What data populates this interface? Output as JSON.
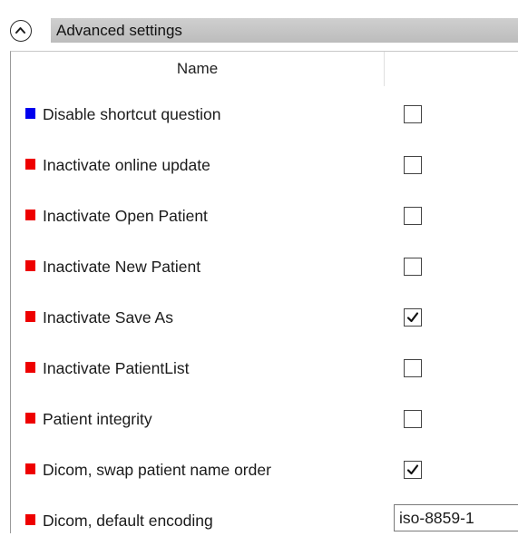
{
  "header": {
    "title": "Advanced settings",
    "collapse_icon": "chevron-up-circle-icon",
    "bar_color": "#c4c4c4"
  },
  "grid": {
    "column_name": "Name",
    "column_value": "",
    "rows": [
      {
        "label": "Disable shortcut question",
        "marker_color": "#0000ee",
        "type": "checkbox",
        "checked": false
      },
      {
        "label": "Inactivate online update",
        "marker_color": "#ee0000",
        "type": "checkbox",
        "checked": false
      },
      {
        "label": "Inactivate Open Patient",
        "marker_color": "#ee0000",
        "type": "checkbox",
        "checked": false
      },
      {
        "label": "Inactivate New Patient",
        "marker_color": "#ee0000",
        "type": "checkbox",
        "checked": false
      },
      {
        "label": "Inactivate Save As",
        "marker_color": "#ee0000",
        "type": "checkbox",
        "checked": true
      },
      {
        "label": "Inactivate PatientList",
        "marker_color": "#ee0000",
        "type": "checkbox",
        "checked": false
      },
      {
        "label": "Patient integrity",
        "marker_color": "#ee0000",
        "type": "checkbox",
        "checked": false
      },
      {
        "label": "Dicom, swap patient name order",
        "marker_color": "#ee0000",
        "type": "checkbox",
        "checked": true
      },
      {
        "label": "Dicom, default encoding",
        "marker_color": "#ee0000",
        "type": "text",
        "value": "iso-8859-1"
      }
    ]
  }
}
